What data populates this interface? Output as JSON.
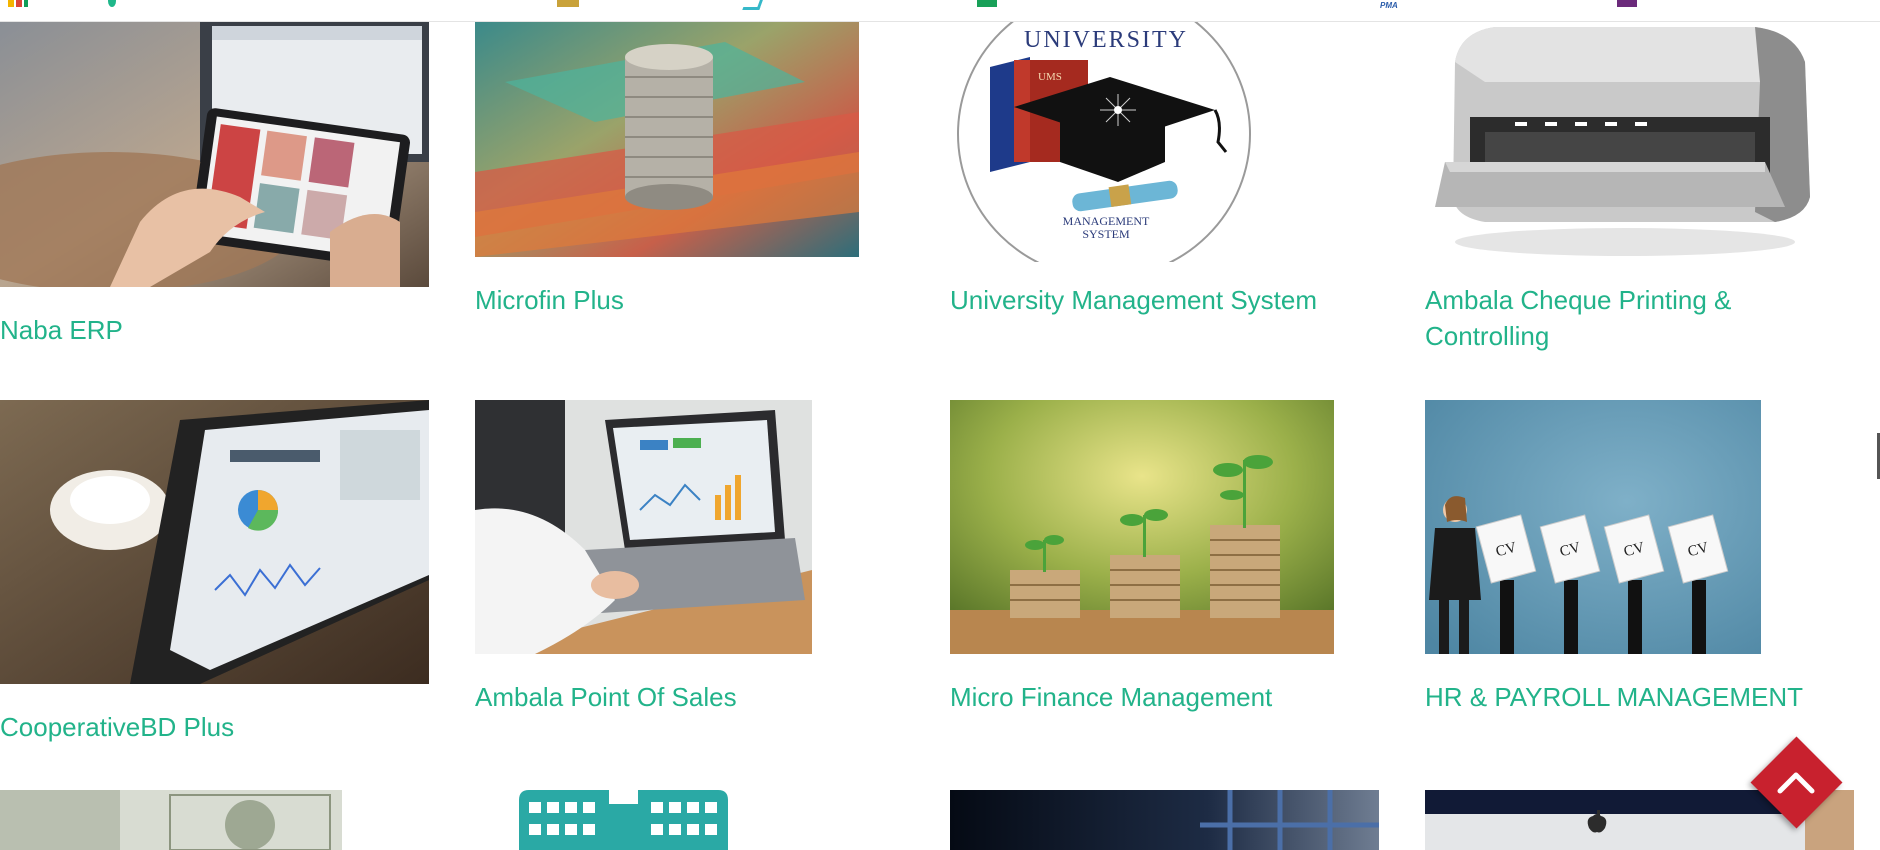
{
  "products": [
    {
      "name": "Naba ERP",
      "image_alt": "tablet-in-hands-photo"
    },
    {
      "name": "Microfin Plus",
      "image_alt": "coins-and-banknotes-photo"
    },
    {
      "name": "University Management System",
      "image_alt": "university-logo"
    },
    {
      "name": "Ambala Cheque Printing & Controlling",
      "image_alt": "printer-photo"
    },
    {
      "name": "CooperativeBD Plus",
      "image_alt": "tablet-dashboard-photo"
    },
    {
      "name": "Ambala Point Of Sales",
      "image_alt": "laptop-user-photo"
    },
    {
      "name": "Micro Finance Management",
      "image_alt": "coin-stacks-plants-photo"
    },
    {
      "name": "HR & PAYROLL MANAGEMENT",
      "image_alt": "cv-candidates-illustration"
    }
  ],
  "ums_logo": {
    "top_text": "UNIVERSITY",
    "book_text": "UMS",
    "bottom_line1": "MANAGEMENT",
    "bottom_line2": "SYSTEM"
  },
  "hr_cards": [
    "CV",
    "CV",
    "CV",
    "CV"
  ],
  "bookmarks": {
    "pma_label": "PMA"
  },
  "scroll_top": {
    "icon": "chevron-up-icon"
  },
  "colors": {
    "link": "#22b38a",
    "scroll_button": "#c8212e"
  }
}
